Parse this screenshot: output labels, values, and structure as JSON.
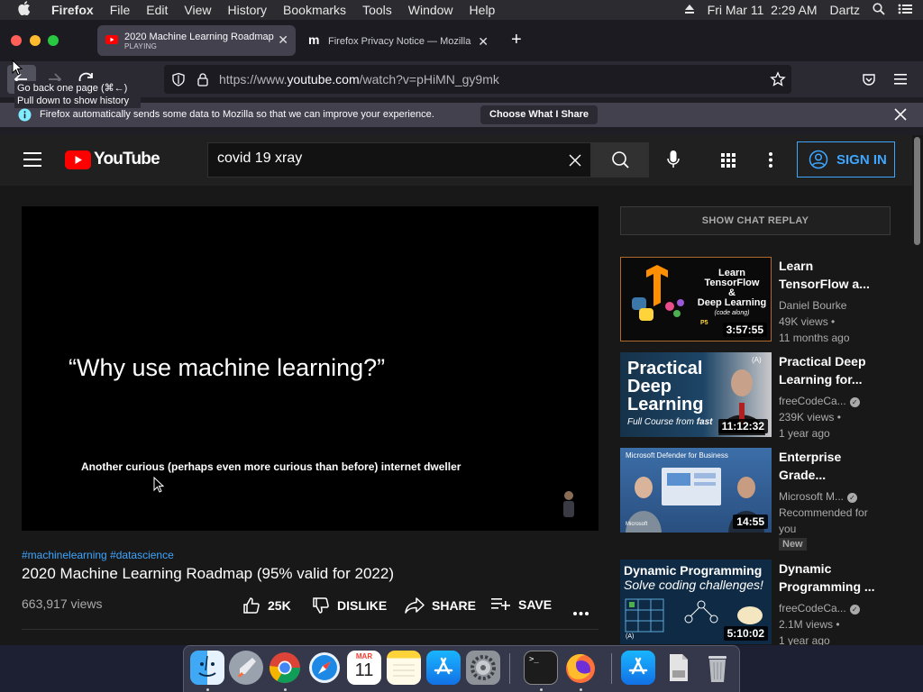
{
  "menubar": {
    "app": "Firefox",
    "items": [
      "File",
      "Edit",
      "View",
      "History",
      "Bookmarks",
      "Tools",
      "Window",
      "Help"
    ],
    "datetime": "Fri Mar 11  2:29 AM",
    "user": "Dartz"
  },
  "tabs": [
    {
      "title": "2020 Machine Learning Roadmap",
      "status": "PLAYING"
    },
    {
      "title": "Firefox Privacy Notice — Mozilla"
    }
  ],
  "nav": {
    "url_prefix": "https://www.",
    "url_domain": "youtube.com",
    "url_path": "/watch?v=pHiMN_gy9mk",
    "tooltip_line1": "Go back one page (⌘←)",
    "tooltip_line2": "Pull down to show history"
  },
  "notice": {
    "message": "Firefox automatically sends some data to Mozilla so that we can improve your experience.",
    "button": "Choose What I Share"
  },
  "youtube": {
    "logo": "YouTube",
    "search_value": "covid 19 xray",
    "sign_in": "SIGN IN",
    "video": {
      "quote": "“Why use machine learning?”",
      "subtitle": "Another curious (perhaps even more curious than before) internet dweller",
      "tags": "#machinelearning #datascience",
      "title": "2020 Machine Learning Roadmap (95% valid for 2022)",
      "views": "663,917 views",
      "likes": "25K",
      "dislike": "DISLIKE",
      "share": "SHARE",
      "save": "SAVE"
    },
    "chat_replay": "SHOW CHAT REPLAY",
    "recommendations": [
      {
        "title_lines": [
          "Learn",
          "TensorFlow a..."
        ],
        "channel": "Daniel Bourke",
        "verified": false,
        "views": "49K views",
        "age": "11 months ago",
        "duration": "3:57:55",
        "thumb_text": [
          "Learn",
          "TensorFlow",
          "&",
          "Deep Learning",
          "(code along)",
          "P5"
        ]
      },
      {
        "title_lines": [
          "Practical Deep",
          "Learning for..."
        ],
        "channel": "freeCodeCa...",
        "verified": true,
        "views": "239K views",
        "age": "1 year ago",
        "duration": "11:12:32",
        "thumb_text": [
          "Practical",
          "Deep",
          "Learning",
          "Full Course from",
          "fast",
          "(A)"
        ]
      },
      {
        "title_lines": [
          "Enterprise",
          "Grade..."
        ],
        "channel": "Microsoft M...",
        "verified": true,
        "views": "Recommended for",
        "age": "you",
        "badge": "New",
        "duration": "14:55",
        "thumb_text": [
          "Microsoft Defender for Business",
          "Microsoft"
        ]
      },
      {
        "title_lines": [
          "Dynamic",
          "Programming ..."
        ],
        "channel": "freeCodeCa...",
        "verified": true,
        "views": "2.1M views",
        "age": "1 year ago",
        "duration": "5:10:02",
        "thumb_text": [
          "Dynamic Programming",
          "Solve coding challenges!",
          "(A)"
        ]
      }
    ]
  },
  "dock": {
    "apps": [
      "Finder",
      "Launchpad",
      "Chrome",
      "Safari",
      "Calendar",
      "Notes",
      "App Store",
      "System Preferences",
      "Terminal",
      "Firefox",
      "App Store",
      "Preview",
      "Trash"
    ],
    "calendar_month": "MAR",
    "calendar_day": "11"
  },
  "colors": {
    "yt_red": "#ff0000",
    "yt_link_blue": "#3ea6ff",
    "firefox_toolbar": "#2b2a33"
  }
}
